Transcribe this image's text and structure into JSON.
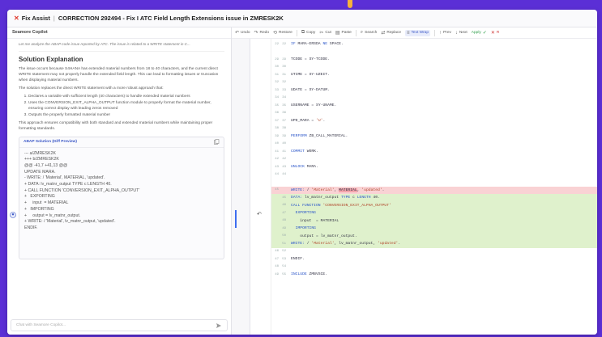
{
  "title_bar": {
    "app_name": "Fix Assist",
    "title": "CORRECTION 292494 - Fix I ATC Field Length Extensions issue in ZMRESK2K"
  },
  "copilot": {
    "header": "Seamore Copilot",
    "intro": "Let me analyze the ABAP code issue reported by ATC. The issue is related to a WRITE statement in C...",
    "heading": "Solution Explanation",
    "paragraph1": "The issue occurs because S4HANA has extended material numbers from 18 to 40 characters, and the current direct WRITE statement may not properly handle the extended field length. This can lead to formatting issues or truncation when displaying material numbers.",
    "paragraph2": "The solution replaces the direct WRITE statement with a more robust approach that:",
    "steps": [
      "Declares a variable with sufficient length (40 characters) to handle extended material numbers",
      "Uses the CONVERSION_EXIT_ALPHA_OUTPUT function module to properly format the material number, ensuring correct display with leading zeros removed",
      "Outputs the properly formatted material number"
    ],
    "paragraph3": "This approach ensures compatibility with both standard and extended material numbers while maintaining proper formatting standards.",
    "code_card": {
      "title": "ABAP Solution (Diff Preview)",
      "lines": [
        "--- a/ZMRESK2K",
        "+++ b/ZMRESK2K",
        "@@ -41,7 +41,13 @@",
        "",
        "UPDATE MARA.",
        "",
        "- WRITE: / 'Material', MATERIAL, 'updated'.",
        "+ DATA: lv_matnr_output TYPE c LENGTH 40.",
        "+ CALL FUNCTION 'CONVERSION_EXIT_ALPHA_OUTPUT'",
        "+   EXPORTING",
        "+     input  = MATERIAL",
        "+   IMPORTING",
        "+     output = lv_matnr_output.",
        "+ WRITE: / 'Material', lv_matnr_output, 'updated'.",
        "",
        "ENDIF."
      ]
    },
    "input_placeholder": "Chat with Seamore Copilot..."
  },
  "toolbar": {
    "undo": "Undo",
    "redo": "Redo",
    "restore": "Restore",
    "copy": "Copy",
    "cut": "Cut",
    "paste": "Paste",
    "search": "Search",
    "replace": "Replace",
    "text_wrap": "Text Wrap",
    "prev": "Prev",
    "next": "Next",
    "apply": "Apply",
    "reject": "R"
  },
  "editor": {
    "rows": [
      {
        "l1": "22",
        "l2": "22",
        "type": "normal",
        "text": "IF MARA-ERSDA NE SPACE."
      },
      {
        "l1": "",
        "l2": "",
        "type": "normal",
        "text": ""
      },
      {
        "l1": "29",
        "l2": "29",
        "type": "normal",
        "text": "TCODE = SY-TCODE."
      },
      {
        "l1": "30",
        "l2": "30",
        "type": "normal",
        "text": ""
      },
      {
        "l1": "31",
        "l2": "31",
        "type": "normal",
        "text": "UTIME = SY-UZEIT."
      },
      {
        "l1": "32",
        "l2": "32",
        "type": "normal",
        "text": ""
      },
      {
        "l1": "33",
        "l2": "33",
        "type": "normal",
        "text": "UDATE = SY-DATUM."
      },
      {
        "l1": "34",
        "l2": "34",
        "type": "normal",
        "text": ""
      },
      {
        "l1": "35",
        "l2": "35",
        "type": "normal",
        "text": "USERNAME = SY-UNAME."
      },
      {
        "l1": "36",
        "l2": "36",
        "type": "normal",
        "text": ""
      },
      {
        "l1": "37",
        "l2": "37",
        "type": "normal",
        "text": "UPD_MARA = 'U'."
      },
      {
        "l1": "38",
        "l2": "38",
        "type": "normal",
        "text": ""
      },
      {
        "l1": "39",
        "l2": "39",
        "type": "normal",
        "text": "PERFORM ZB_CALL_MATERIAL."
      },
      {
        "l1": "40",
        "l2": "40",
        "type": "normal",
        "text": ""
      },
      {
        "l1": "41",
        "l2": "41",
        "type": "normal",
        "text": "COMMIT WORK."
      },
      {
        "l1": "42",
        "l2": "42",
        "type": "normal",
        "text": ""
      },
      {
        "l1": "43",
        "l2": "43",
        "type": "normal",
        "text": "UNLOCK MARA."
      },
      {
        "l1": "44",
        "l2": "44",
        "type": "normal",
        "text": ""
      },
      {
        "l1": "",
        "l2": "",
        "type": "normal",
        "text": ""
      },
      {
        "l1": "45",
        "l2": "",
        "type": "del",
        "text": "WRITE: / 'Material', MATERIAL, 'updated'."
      },
      {
        "l1": "",
        "l2": "45",
        "type": "add",
        "text": "DATA: lv_matnr_output TYPE c LENGTH 40."
      },
      {
        "l1": "",
        "l2": "46",
        "type": "add",
        "text": "CALL FUNCTION 'CONVERSION_EXIT_ALPHA_OUTPUT'"
      },
      {
        "l1": "",
        "l2": "47",
        "type": "add",
        "text": "  EXPORTING"
      },
      {
        "l1": "",
        "l2": "48",
        "type": "add",
        "text": "    input  = MATERIAL"
      },
      {
        "l1": "",
        "l2": "49",
        "type": "add",
        "text": "  IMPORTING"
      },
      {
        "l1": "",
        "l2": "50",
        "type": "add",
        "text": "    output = lv_matnr_output."
      },
      {
        "l1": "",
        "l2": "51",
        "type": "add",
        "text": "WRITE: / 'Material', lv_matnr_output, 'updated'."
      },
      {
        "l1": "46",
        "l2": "52",
        "type": "normal",
        "text": ""
      },
      {
        "l1": "47",
        "l2": "53",
        "type": "normal",
        "text": "ENDIF."
      },
      {
        "l1": "48",
        "l2": "54",
        "type": "normal",
        "text": ""
      },
      {
        "l1": "49",
        "l2": "55",
        "type": "normal",
        "text": "INCLUDE ZMBVSCE."
      }
    ]
  },
  "colors": {
    "background": "#5b2fd6",
    "accent": "#3d59c7",
    "deleted": "#f9d2d4",
    "added": "#dff1cc"
  }
}
